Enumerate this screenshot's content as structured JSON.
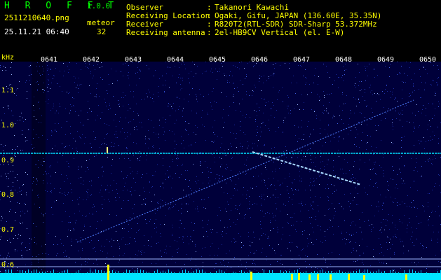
{
  "header": {
    "app_name": "H R O F F T",
    "version": "1.0.0",
    "filename": "2511210640.png",
    "datetime": "25.11.21 06:40",
    "meteor_label": "meteor",
    "meteor_count": "32",
    "info": [
      {
        "key": "Observer",
        "value": "Takanori Kawachi"
      },
      {
        "key": "Receiving Location",
        "value": "Ogaki, Gifu, JAPAN (136.60E, 35.35N)"
      },
      {
        "key": "Receiver",
        "value": "R820T2(RTL-SDR) SDR-Sharp 53.372MHz"
      },
      {
        "key": "Receiving antenna",
        "value": "2el-HB9CV Vertical (el. E-W)"
      }
    ]
  },
  "axis": {
    "y_unit": "kHz",
    "y_ticks": [
      "1.1",
      "1.0",
      "0.9",
      "0.8",
      "0.7",
      "0.6"
    ],
    "x_ticks": [
      "0641",
      "0642",
      "0643",
      "0644",
      "0645",
      "0646",
      "0647",
      "0648",
      "0649",
      "0650"
    ]
  },
  "colors": {
    "background": "#000000",
    "spectrum_base": "#00003a",
    "carrier": "#00e0ff",
    "header_yellow": "#ffff00",
    "meteor_bar": "#ffff00",
    "bottom_bar": "#00e5ff"
  }
}
